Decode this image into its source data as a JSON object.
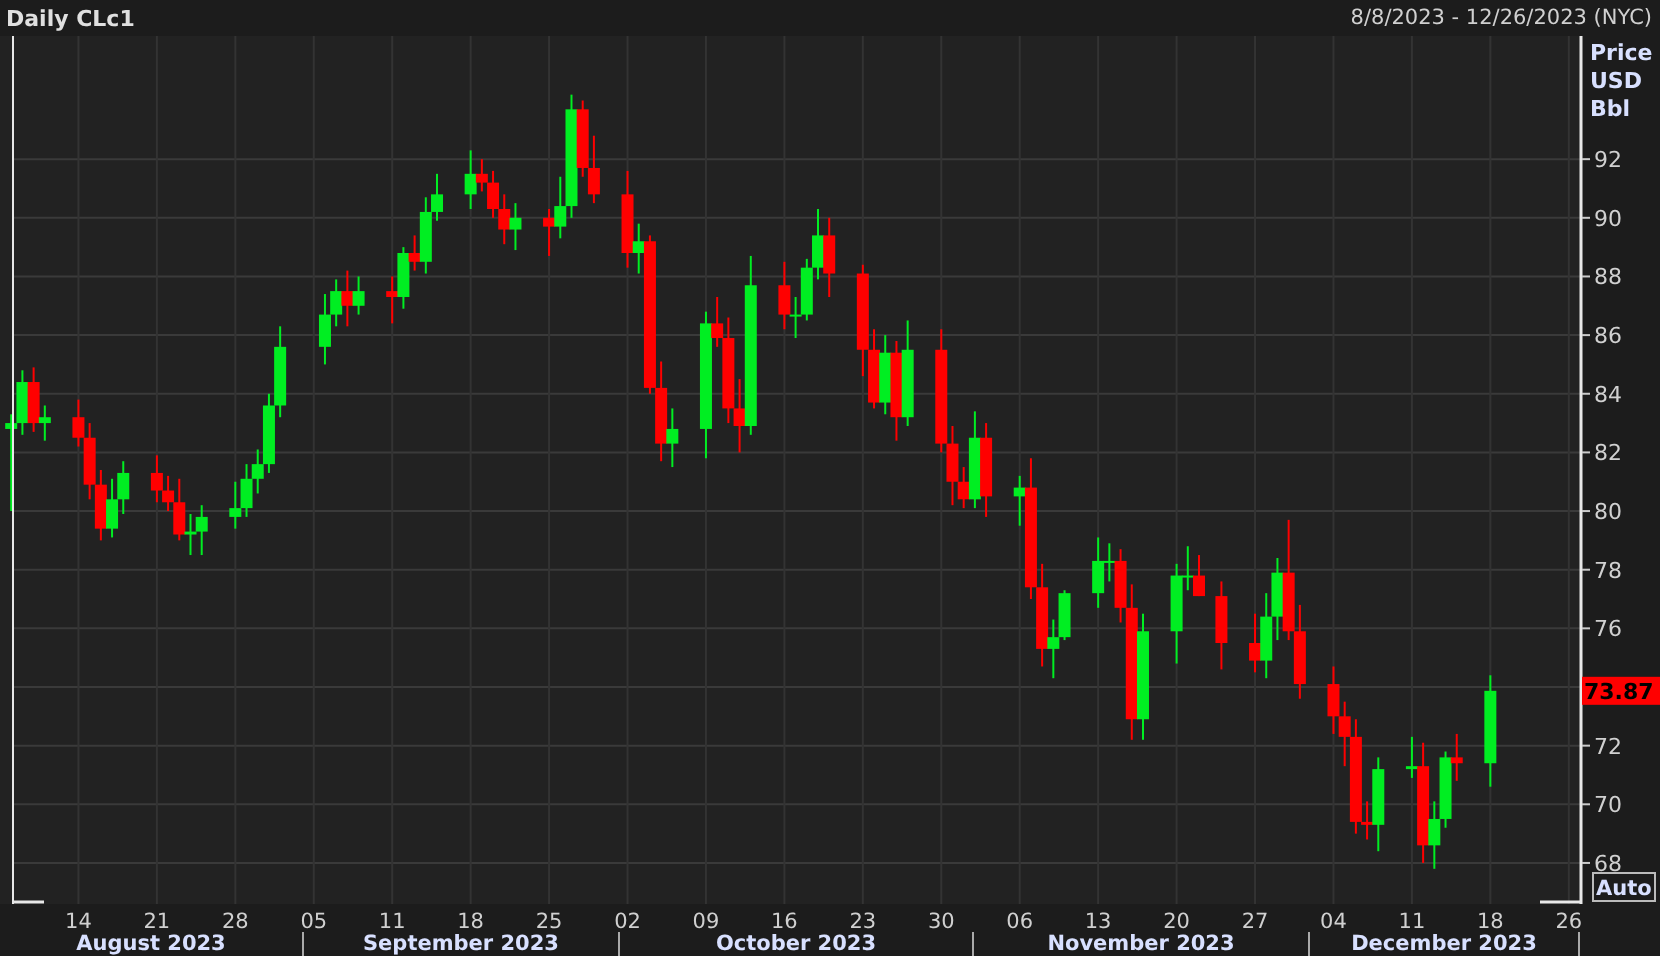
{
  "header": {
    "title": "Daily CLc1",
    "range": "8/8/2023 - 12/26/2023 (NYC)"
  },
  "price_axis": {
    "unit_lines": [
      "Price",
      "USD",
      "Bbl"
    ],
    "last_price": "73.87",
    "scale_button": "Auto"
  },
  "chart_data": {
    "type": "candlestick",
    "xlim": [
      "2023-08-07",
      "2023-12-26"
    ],
    "ylim": [
      66.6,
      96.2
    ],
    "grid": true,
    "xticks": [
      {
        "value": "2023-08-14",
        "label": "14"
      },
      {
        "value": "2023-08-21",
        "label": "21"
      },
      {
        "value": "2023-08-28",
        "label": "28"
      },
      {
        "value": "2023-09-04",
        "label": "05"
      },
      {
        "value": "2023-09-11",
        "label": "11"
      },
      {
        "value": "2023-09-18",
        "label": "18"
      },
      {
        "value": "2023-09-25",
        "label": "25"
      },
      {
        "value": "2023-10-02",
        "label": "02"
      },
      {
        "value": "2023-10-09",
        "label": "09"
      },
      {
        "value": "2023-10-16",
        "label": "16"
      },
      {
        "value": "2023-10-23",
        "label": "23"
      },
      {
        "value": "2023-10-30",
        "label": "30"
      },
      {
        "value": "2023-11-06",
        "label": "06"
      },
      {
        "value": "2023-11-13",
        "label": "13"
      },
      {
        "value": "2023-11-20",
        "label": "20"
      },
      {
        "value": "2023-11-27",
        "label": "27"
      },
      {
        "value": "2023-12-04",
        "label": "04"
      },
      {
        "value": "2023-12-11",
        "label": "11"
      },
      {
        "value": "2023-12-18",
        "label": "18"
      },
      {
        "value": "2023-12-25",
        "label": "26"
      }
    ],
    "yticks": [
      92,
      90,
      88,
      86,
      84,
      82,
      80,
      78,
      76,
      72,
      70,
      68
    ],
    "x": [
      "2023-08-08",
      "2023-08-09",
      "2023-08-10",
      "2023-08-11",
      "2023-08-14",
      "2023-08-15",
      "2023-08-16",
      "2023-08-17",
      "2023-08-18",
      "2023-08-21",
      "2023-08-22",
      "2023-08-23",
      "2023-08-24",
      "2023-08-25",
      "2023-08-28",
      "2023-08-29",
      "2023-08-30",
      "2023-08-31",
      "2023-09-01",
      "2023-09-05",
      "2023-09-06",
      "2023-09-07",
      "2023-09-08",
      "2023-09-11",
      "2023-09-12",
      "2023-09-13",
      "2023-09-14",
      "2023-09-15",
      "2023-09-18",
      "2023-09-19",
      "2023-09-20",
      "2023-09-21",
      "2023-09-22",
      "2023-09-25",
      "2023-09-26",
      "2023-09-27",
      "2023-09-28",
      "2023-09-29",
      "2023-10-02",
      "2023-10-03",
      "2023-10-04",
      "2023-10-05",
      "2023-10-06",
      "2023-10-09",
      "2023-10-10",
      "2023-10-11",
      "2023-10-12",
      "2023-10-13",
      "2023-10-16",
      "2023-10-17",
      "2023-10-18",
      "2023-10-19",
      "2023-10-20",
      "2023-10-23",
      "2023-10-24",
      "2023-10-25",
      "2023-10-26",
      "2023-10-27",
      "2023-10-30",
      "2023-10-31",
      "2023-11-01",
      "2023-11-02",
      "2023-11-03",
      "2023-11-06",
      "2023-11-07",
      "2023-11-08",
      "2023-11-09",
      "2023-11-10",
      "2023-11-13",
      "2023-11-14",
      "2023-11-15",
      "2023-11-16",
      "2023-11-17",
      "2023-11-20",
      "2023-11-21",
      "2023-11-22",
      "2023-11-24",
      "2023-11-27",
      "2023-11-28",
      "2023-11-29",
      "2023-11-30",
      "2023-12-01",
      "2023-12-04",
      "2023-12-05",
      "2023-12-06",
      "2023-12-07",
      "2023-12-08",
      "2023-12-11",
      "2023-12-12",
      "2023-12-13",
      "2023-12-14",
      "2023-12-15",
      "2023-12-18"
    ],
    "ohlc": [
      [
        82.8,
        83.3,
        80.0,
        83.0
      ],
      [
        83.0,
        84.8,
        82.6,
        84.4
      ],
      [
        84.4,
        84.9,
        82.7,
        83.0
      ],
      [
        83.0,
        83.6,
        82.4,
        83.2
      ],
      [
        83.2,
        83.8,
        82.2,
        82.5
      ],
      [
        82.5,
        83.0,
        80.4,
        80.9
      ],
      [
        80.9,
        81.4,
        79.0,
        79.4
      ],
      [
        79.4,
        81.1,
        79.1,
        80.4
      ],
      [
        80.4,
        81.7,
        79.9,
        81.3
      ],
      [
        81.3,
        81.9,
        80.3,
        80.7
      ],
      [
        80.7,
        81.2,
        80.0,
        80.3
      ],
      [
        80.3,
        81.1,
        79.0,
        79.2
      ],
      [
        79.2,
        79.9,
        78.5,
        79.3
      ],
      [
        79.3,
        80.2,
        78.5,
        79.8
      ],
      [
        79.8,
        81.0,
        79.4,
        80.1
      ],
      [
        80.1,
        81.6,
        79.8,
        81.1
      ],
      [
        81.1,
        82.1,
        80.6,
        81.6
      ],
      [
        81.6,
        84.0,
        81.3,
        83.6
      ],
      [
        83.6,
        86.3,
        83.2,
        85.6
      ],
      [
        85.6,
        87.4,
        85.0,
        86.7
      ],
      [
        86.7,
        87.9,
        86.3,
        87.5
      ],
      [
        87.5,
        88.2,
        86.3,
        87.0
      ],
      [
        87.0,
        88.0,
        86.7,
        87.5
      ],
      [
        87.5,
        88.0,
        86.4,
        87.3
      ],
      [
        87.3,
        89.0,
        86.9,
        88.8
      ],
      [
        88.8,
        89.4,
        88.2,
        88.5
      ],
      [
        88.5,
        90.7,
        88.1,
        90.2
      ],
      [
        90.2,
        91.5,
        89.9,
        90.8
      ],
      [
        90.8,
        92.3,
        90.3,
        91.5
      ],
      [
        91.5,
        92.0,
        90.9,
        91.2
      ],
      [
        91.2,
        91.6,
        90.0,
        90.3
      ],
      [
        90.3,
        90.8,
        89.1,
        89.6
      ],
      [
        89.6,
        90.5,
        88.9,
        90.0
      ],
      [
        90.0,
        90.3,
        88.7,
        89.7
      ],
      [
        89.7,
        91.4,
        89.3,
        90.4
      ],
      [
        90.4,
        94.2,
        90.0,
        93.7
      ],
      [
        93.7,
        94.0,
        91.4,
        91.7
      ],
      [
        91.7,
        92.8,
        90.5,
        90.8
      ],
      [
        90.8,
        91.6,
        88.3,
        88.8
      ],
      [
        88.8,
        89.8,
        88.1,
        89.2
      ],
      [
        89.2,
        89.4,
        84.0,
        84.2
      ],
      [
        84.2,
        85.1,
        81.7,
        82.3
      ],
      [
        82.3,
        83.5,
        81.5,
        82.8
      ],
      [
        82.8,
        86.8,
        81.8,
        86.4
      ],
      [
        86.4,
        87.3,
        85.6,
        85.9
      ],
      [
        85.9,
        86.6,
        83.0,
        83.5
      ],
      [
        83.5,
        84.5,
        82.0,
        82.9
      ],
      [
        82.9,
        88.7,
        82.6,
        87.7
      ],
      [
        87.7,
        88.5,
        86.2,
        86.7
      ],
      [
        86.7,
        87.3,
        85.9,
        86.7
      ],
      [
        86.7,
        88.6,
        86.5,
        88.3
      ],
      [
        88.3,
        90.3,
        87.9,
        89.4
      ],
      [
        89.4,
        90.0,
        87.3,
        88.1
      ],
      [
        88.1,
        88.4,
        84.6,
        85.5
      ],
      [
        85.5,
        86.2,
        83.5,
        83.7
      ],
      [
        83.7,
        86.0,
        83.3,
        85.4
      ],
      [
        85.4,
        85.8,
        82.4,
        83.2
      ],
      [
        83.2,
        86.5,
        82.9,
        85.5
      ],
      [
        85.5,
        86.2,
        82.0,
        82.3
      ],
      [
        82.3,
        82.9,
        80.2,
        81.0
      ],
      [
        81.0,
        81.5,
        80.1,
        80.4
      ],
      [
        80.4,
        83.4,
        80.1,
        82.5
      ],
      [
        82.5,
        83.0,
        79.8,
        80.5
      ],
      [
        80.5,
        81.2,
        79.5,
        80.8
      ],
      [
        80.8,
        81.8,
        77.0,
        77.4
      ],
      [
        77.4,
        78.2,
        74.7,
        75.3
      ],
      [
        75.3,
        76.3,
        74.3,
        75.7
      ],
      [
        75.7,
        77.3,
        75.6,
        77.2
      ],
      [
        77.2,
        79.1,
        76.7,
        78.3
      ],
      [
        78.3,
        78.9,
        77.6,
        78.3
      ],
      [
        78.3,
        78.7,
        76.2,
        76.7
      ],
      [
        76.7,
        77.5,
        72.2,
        72.9
      ],
      [
        72.9,
        76.5,
        72.2,
        75.9
      ],
      [
        75.9,
        78.2,
        74.8,
        77.8
      ],
      [
        77.8,
        78.8,
        77.3,
        77.8
      ],
      [
        77.8,
        78.5,
        77.1,
        77.1
      ],
      [
        77.1,
        77.6,
        74.6,
        75.5
      ],
      [
        75.5,
        76.5,
        74.5,
        74.9
      ],
      [
        74.9,
        77.2,
        74.3,
        76.4
      ],
      [
        76.4,
        78.4,
        75.6,
        77.9
      ],
      [
        77.9,
        79.7,
        75.6,
        75.9
      ],
      [
        75.9,
        76.8,
        73.6,
        74.1
      ],
      [
        74.1,
        74.7,
        72.4,
        73.0
      ],
      [
        73.0,
        73.5,
        71.3,
        72.3
      ],
      [
        72.3,
        72.9,
        69.0,
        69.4
      ],
      [
        69.4,
        70.1,
        68.8,
        69.3
      ],
      [
        69.3,
        71.6,
        68.4,
        71.2
      ],
      [
        71.2,
        72.3,
        70.9,
        71.3
      ],
      [
        71.3,
        72.1,
        68.0,
        68.6
      ],
      [
        68.6,
        70.1,
        67.8,
        69.5
      ],
      [
        69.5,
        71.8,
        69.2,
        71.6
      ],
      [
        71.6,
        72.4,
        70.8,
        71.4
      ],
      [
        71.4,
        74.4,
        70.6,
        73.87
      ]
    ]
  },
  "time_axis": {
    "months": [
      "August 2023",
      "September 2023",
      "October 2023",
      "November 2023",
      "December 2023"
    ]
  }
}
